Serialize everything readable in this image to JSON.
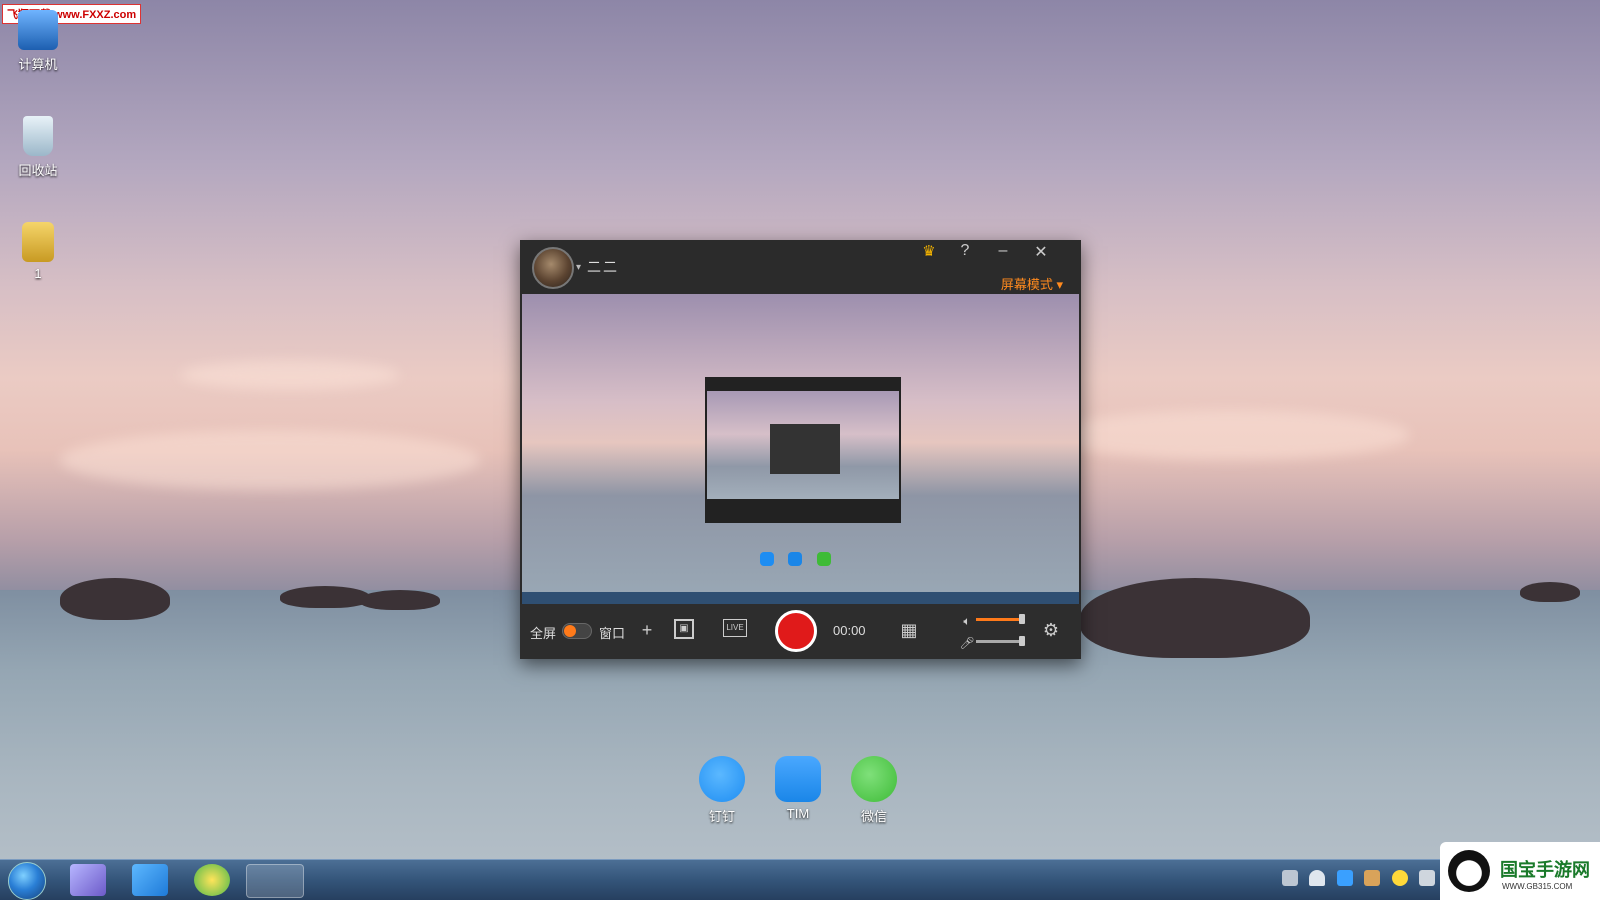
{
  "watermark_top": "飞翔下载 www.FXXZ.com",
  "desktop_icons": [
    {
      "label": "计算机",
      "icon": "computer-icon"
    },
    {
      "label": "回收站",
      "icon": "recycle-bin-icon"
    },
    {
      "label": "1",
      "icon": "folder-icon"
    }
  ],
  "recorder": {
    "username": "二二",
    "help_label": "?",
    "mode_label": "屏幕模式",
    "fullscreen_label": "全屏",
    "window_label": "窗口",
    "timer": "00:00",
    "speaker_volume": 0.9,
    "mic_volume": 0.9,
    "icons": [
      "vip-crown-icon",
      "help-icon",
      "minimize-icon",
      "close-icon",
      "add-icon",
      "region-icon",
      "live-icon",
      "record-icon",
      "filmstrip-icon",
      "speaker-icon",
      "mic-icon",
      "settings-icon"
    ]
  },
  "apps": [
    {
      "label": "钉钉",
      "icon": "dingtalk-icon",
      "color": "#1e8df2"
    },
    {
      "label": "TIM",
      "icon": "tim-icon",
      "color": "#1a86e8"
    },
    {
      "label": "微信",
      "icon": "wechat-icon",
      "color": "#3ebb37"
    }
  ],
  "watermark_br": {
    "brand": "国宝手游网",
    "url": "WWW.GB315.COM"
  },
  "colors": {
    "accent": "#ff7a1a",
    "record": "#e01a1a",
    "taskbar": "#34557a"
  }
}
